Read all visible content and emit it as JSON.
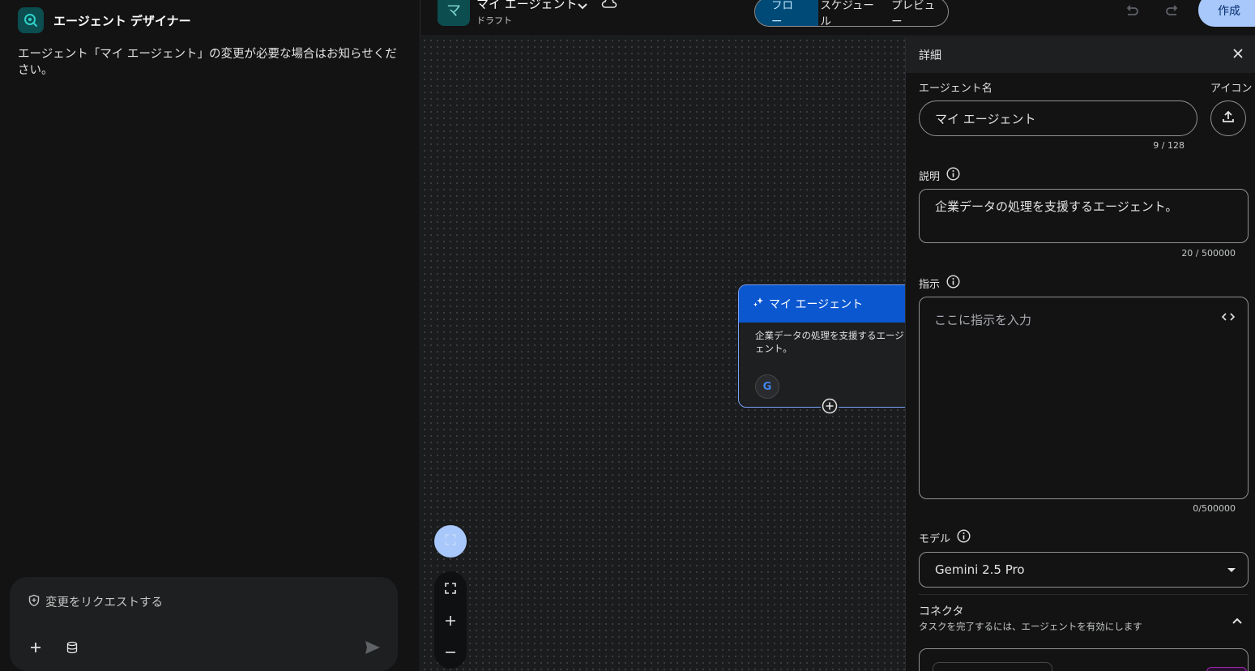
{
  "left_panel": {
    "title": "エージェント デザイナー",
    "message": "エージェント「マイ エージェント」の変更が必要な場合はお知らせください。",
    "composer_placeholder": "変更をリクエストする",
    "composer_icons": [
      "shield-icon",
      "plus-icon",
      "database-icon",
      "send-icon"
    ]
  },
  "header": {
    "agent_initial": "マ",
    "agent_name": "マイ エージェント",
    "status": "ドラフト",
    "tabs": [
      {
        "label": "フロー",
        "active": true
      },
      {
        "label": "スケジュール",
        "active": false
      },
      {
        "label": "プレビュー",
        "active": false
      }
    ],
    "create_label": "作成"
  },
  "canvas": {
    "node_title": "マイ エージェント",
    "node_description": "企業データの処理を支援するエージェント。",
    "node_connector_glyph": "G"
  },
  "details": {
    "title": "詳細",
    "name_label": "エージェント名",
    "icon_label": "アイコン",
    "name_value": "マイ エージェント",
    "name_count": "9 / 128",
    "description_label": "説明",
    "description_value": "企業データの処理を支援するエージェント。",
    "description_count": "20 / 500000",
    "instruction_label": "指示",
    "instruction_placeholder": "ここに指示を入力",
    "instruction_count": "0/500000",
    "model_label": "モデル",
    "model_value": "Gemini 2.5 Pro",
    "connector_title": "コネクタ",
    "connector_subtitle": "タスクを完了するには、エージェントを有効にします"
  },
  "colors": {
    "accent": "#a8c7fa",
    "node_header": "#0b57d0",
    "active_tab": "#004a77",
    "teal_tile": "#0c4d50"
  }
}
